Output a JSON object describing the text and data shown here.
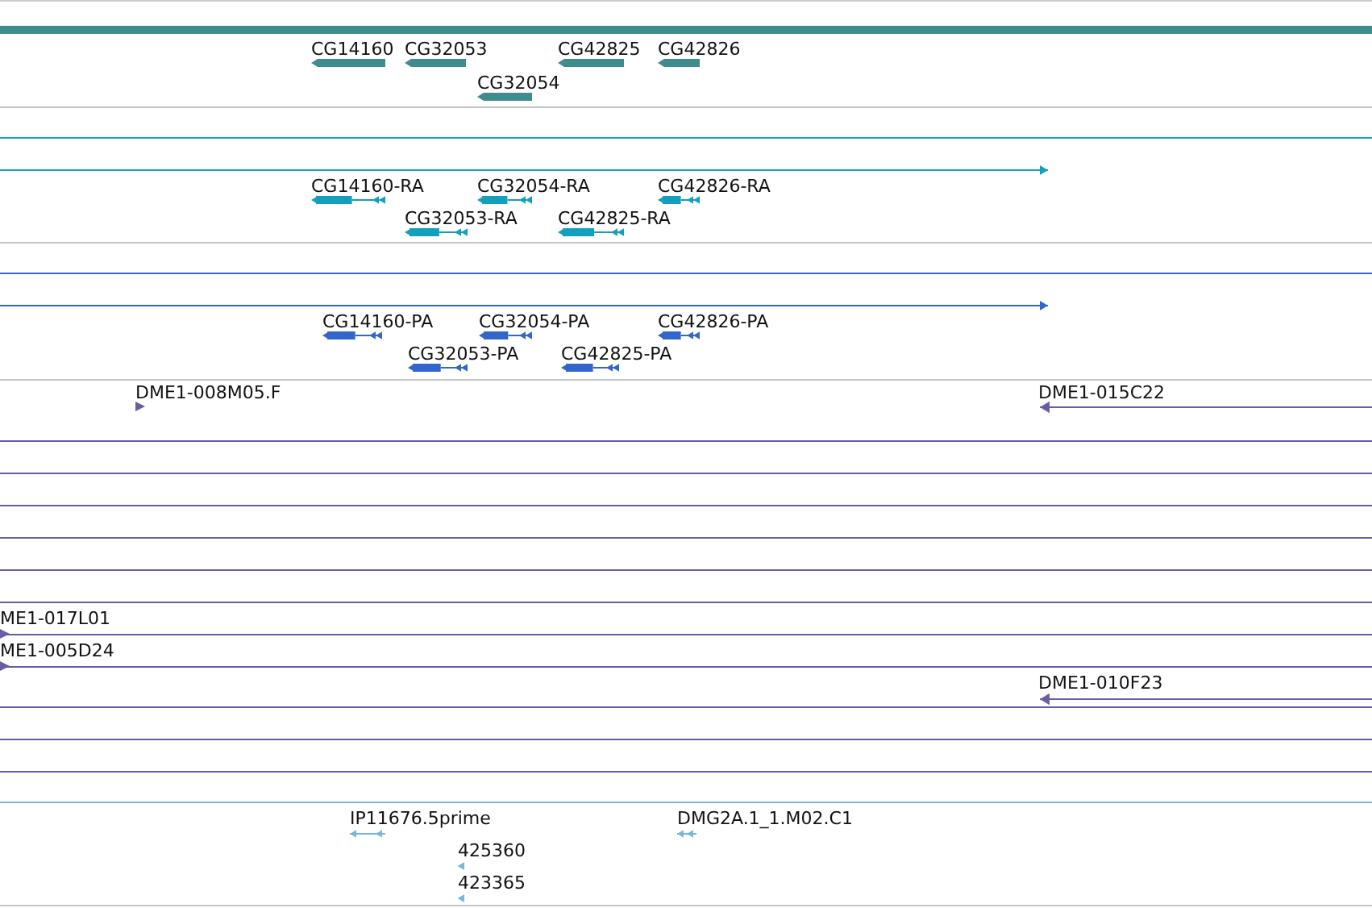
{
  "tracks": [
    {
      "kind": "gene",
      "features": [
        {
          "label": "CG14160",
          "reverse": true
        },
        {
          "label": "CG32053",
          "reverse": true
        },
        {
          "label": "CG42825",
          "reverse": true
        },
        {
          "label": "CG42826",
          "reverse": true
        },
        {
          "label": "CG32054",
          "reverse": true
        }
      ]
    },
    {
      "kind": "transcript",
      "features": [
        {
          "label": "CG14160-RA",
          "reverse": true
        },
        {
          "label": "CG32054-RA",
          "reverse": true
        },
        {
          "label": "CG42826-RA",
          "reverse": true
        },
        {
          "label": "CG32053-RA",
          "reverse": true
        },
        {
          "label": "CG42825-RA",
          "reverse": true
        }
      ],
      "spans": [
        {
          "arrow": true
        }
      ]
    },
    {
      "kind": "protein",
      "features": [
        {
          "label": "CG14160-PA",
          "reverse": true
        },
        {
          "label": "CG32054-PA",
          "reverse": true
        },
        {
          "label": "CG42826-PA",
          "reverse": true
        },
        {
          "label": "CG32053-PA",
          "reverse": true
        },
        {
          "label": "CG42825-PA",
          "reverse": true
        }
      ],
      "spans": [
        {
          "arrow": true
        }
      ]
    },
    {
      "kind": "clone",
      "features": [
        {
          "label": "DME1-008M05.F",
          "reverse": false
        },
        {
          "label": "DME1-015C22",
          "reverse": true
        },
        {
          "label": "ME1-017L01",
          "reverse": false
        },
        {
          "label": "ME1-005D24",
          "reverse": false
        },
        {
          "label": "DME1-010F23",
          "reverse": true
        }
      ]
    },
    {
      "kind": "est",
      "features": [
        {
          "label": "IP11676.5prime",
          "reverse": true
        },
        {
          "label": "DMG2A.1_1.M02.C1",
          "reverse": true
        },
        {
          "label": "425360",
          "reverse": true
        },
        {
          "label": "423365",
          "reverse": true
        }
      ]
    }
  ]
}
